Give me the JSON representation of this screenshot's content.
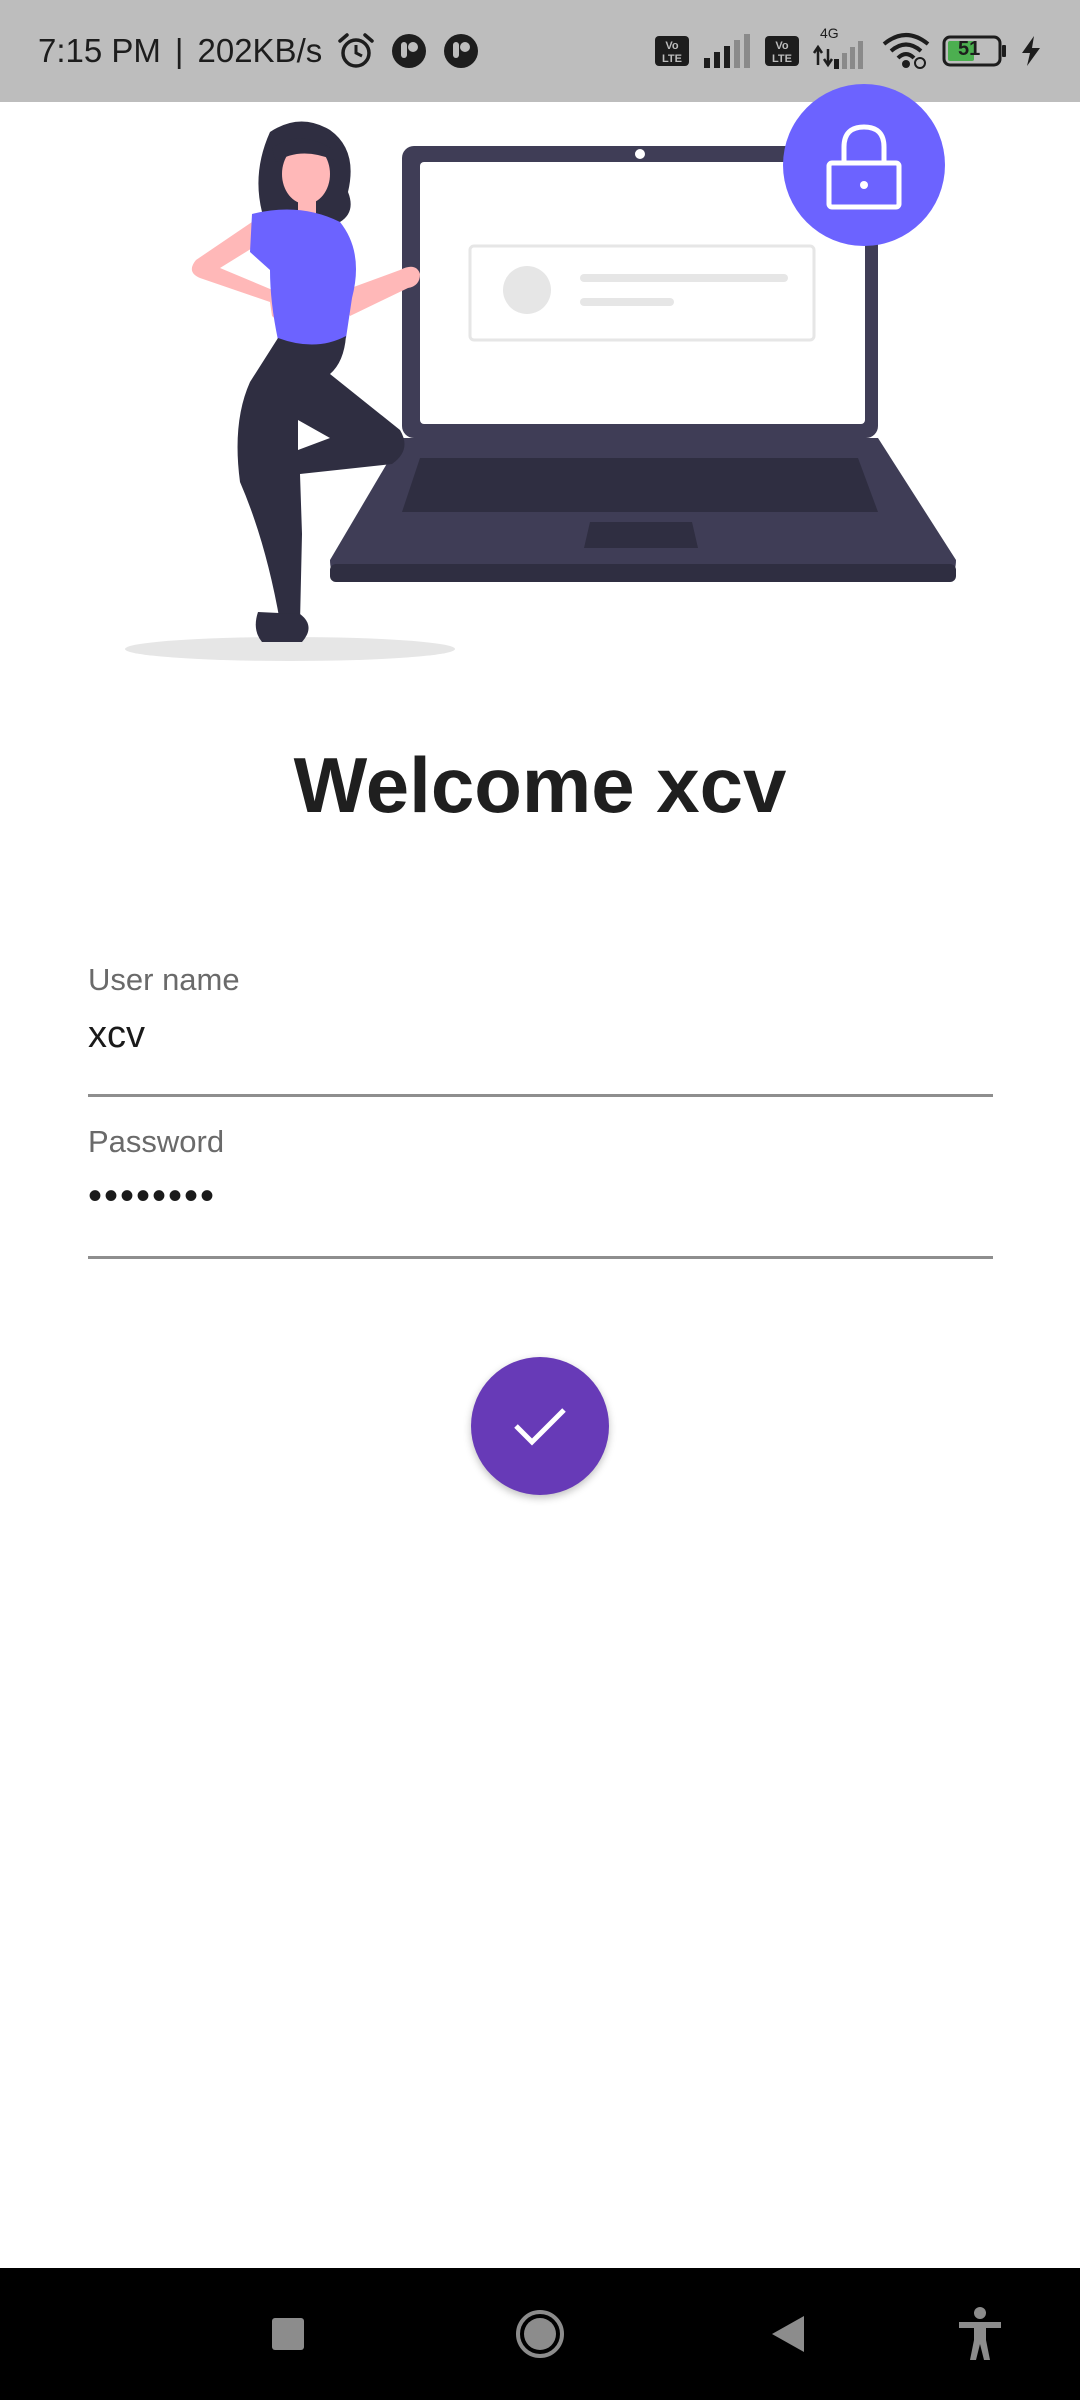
{
  "status_bar": {
    "time": "7:15 PM",
    "separator": "|",
    "speed": "202KB/s",
    "icons_left": [
      "alarm-icon",
      "app-notification-icon",
      "app-notification-icon"
    ],
    "icons_right": [
      "volte-icon",
      "signal-icon",
      "volte-icon",
      "signal-4g-icon",
      "wifi-icon",
      "battery-icon",
      "charging-icon"
    ],
    "network_label": "4G",
    "volte_label": "Vo LTE",
    "battery_level": "51",
    "battery_color": "#4caf50"
  },
  "illustration": {
    "description_icons": [
      "woman-figure-icon",
      "laptop-icon",
      "lock-icon"
    ],
    "accent_color": "#6c63ff"
  },
  "login": {
    "welcome_text": "Welcome xcv",
    "username_label": "User name",
    "username_value": "xcv",
    "password_label": "Password",
    "password_value": "••••••••",
    "submit_icon": "check-icon",
    "submit_color": "#673ab7"
  },
  "nav_bar": {
    "buttons": [
      "recents-square-icon",
      "home-circle-icon",
      "back-triangle-icon",
      "accessibility-icon"
    ]
  }
}
